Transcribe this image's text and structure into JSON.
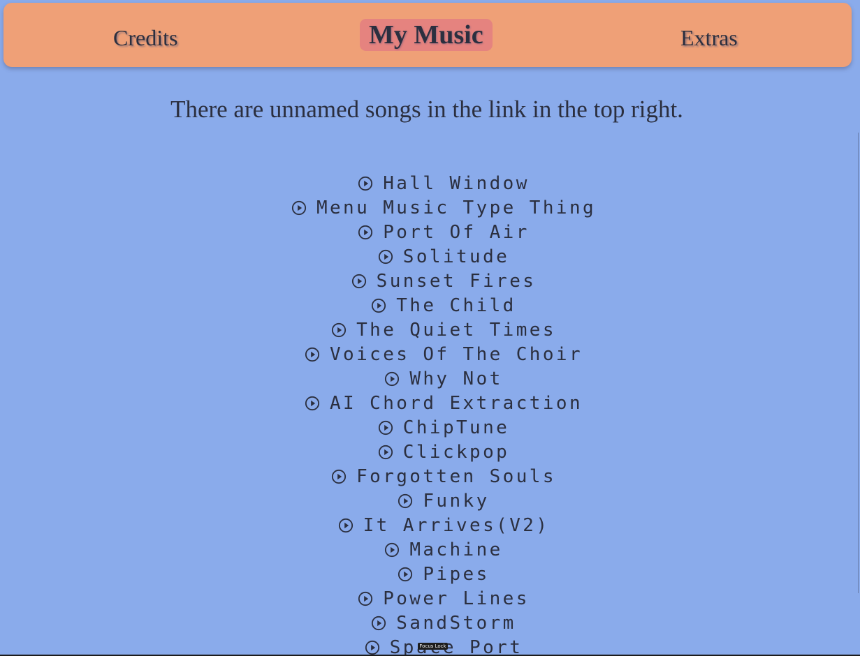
{
  "nav": {
    "credits": "Credits",
    "my_music": "My Music",
    "extras": "Extras"
  },
  "notice": "There are unnamed songs in the link in the top right.",
  "songs": [
    "Hall Window",
    "Menu Music Type Thing",
    "Port Of Air",
    "Solitude",
    "Sunset Fires",
    "The Child",
    "The Quiet Times",
    "Voices Of The Choir",
    "Why Not",
    "AI Chord Extraction",
    "ChipTune",
    "Clickpop",
    "Forgotten Souls",
    "Funky",
    "It Arrives(V2)",
    "Machine",
    "Pipes",
    "Power Lines",
    "SandStorm",
    "Space Port"
  ],
  "focus_badge": "Focus Lock",
  "icons": {
    "song": "play-circle-icon"
  },
  "colors": {
    "background": "#8aabeb",
    "navbar": "#efa077",
    "active_tab": "#e5837f",
    "text": "#2b2f3f"
  }
}
